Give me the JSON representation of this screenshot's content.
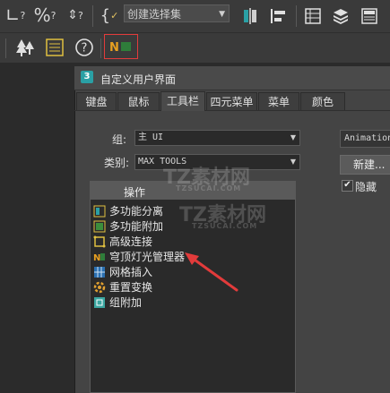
{
  "toolbar_top": {
    "selection_set_placeholder": "创建选择集"
  },
  "dialog": {
    "badge": "3",
    "title": "自定义用户界面",
    "tabs": [
      "键盘",
      "鼠标",
      "工具栏",
      "四元菜单",
      "菜单",
      "颜色"
    ],
    "active_tab": "工具栏",
    "group_label": "组:",
    "group_value": "主 UI",
    "category_label": "类别:",
    "category_value": "MAX TOOLS",
    "list_header": "操作",
    "actions": [
      {
        "label": "多功能分离",
        "icon": "split-icon"
      },
      {
        "label": "多功能附加",
        "icon": "attach-icon"
      },
      {
        "label": "高级连接",
        "icon": "connect-icon"
      },
      {
        "label": "穹顶灯光管理器",
        "icon": "light-manager-icon"
      },
      {
        "label": "网格插入",
        "icon": "grid-insert-icon"
      },
      {
        "label": "重置变换",
        "icon": "reset-xform-icon"
      },
      {
        "label": "组附加",
        "icon": "group-attach-icon"
      }
    ],
    "right_combo_value": "Animation",
    "new_button": "新建...",
    "hide_checkbox_label": "隐藏",
    "hide_checked": true
  },
  "watermark": {
    "brand": "TZ素材网",
    "domain": "TZSUCAI.COM"
  },
  "colors": {
    "highlight_box": "#e23b3b",
    "arrow": "#e23b3b",
    "accent_teal": "#2aa0a5"
  }
}
